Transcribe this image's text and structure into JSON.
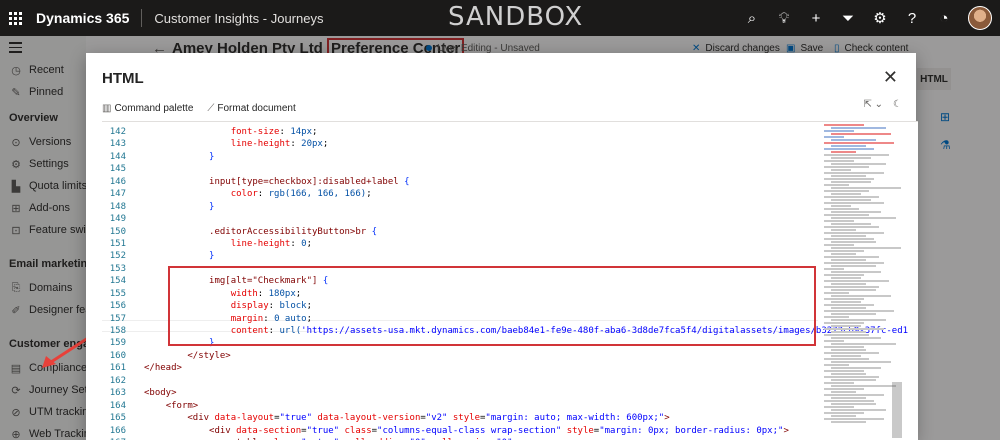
{
  "topbar": {
    "app_name": "Dynamics 365",
    "area_name": "Customer Insights - Journeys",
    "environment_banner": "SANDBOX",
    "icons": [
      "search-icon",
      "lightbulb-icon",
      "plus-icon",
      "filter-icon",
      "gear-icon",
      "help-icon",
      "copilot-icon"
    ]
  },
  "sidebar": {
    "items_top": [
      {
        "label": "Recent",
        "icon": "clock-icon"
      },
      {
        "label": "Pinned",
        "icon": "pin-icon"
      }
    ],
    "section_overview": "Overview",
    "items_overview": [
      {
        "label": "Versions",
        "icon": "versions-icon"
      },
      {
        "label": "Settings",
        "icon": "gear-icon"
      },
      {
        "label": "Quota limits",
        "icon": "quota-icon"
      },
      {
        "label": "Add-ons",
        "icon": "addons-icon"
      },
      {
        "label": "Feature switch",
        "icon": "toggle-icon"
      }
    ],
    "section_email": "Email marketing",
    "items_email": [
      {
        "label": "Domains",
        "icon": "domains-icon"
      },
      {
        "label": "Designer featu",
        "icon": "designer-icon"
      }
    ],
    "section_customer": "Customer engage",
    "items_customer": [
      {
        "label": "Compliance pr",
        "icon": "compliance-icon"
      },
      {
        "label": "Journey Settin",
        "icon": "journey-icon"
      },
      {
        "label": "UTM tracking",
        "icon": "utm-icon"
      },
      {
        "label": "Web Tracking",
        "icon": "web-icon"
      }
    ]
  },
  "record": {
    "title_prefix": "Amey Holden Pty Ltd ",
    "title_highlight": "Preference Center",
    "status": "Live, Editing - Unsaved",
    "commands": [
      {
        "label": "Discard changes",
        "icon": "close-icon"
      },
      {
        "label": "Save",
        "icon": "save-icon"
      },
      {
        "label": "Check content",
        "icon": "document-check-icon"
      }
    ],
    "right_panel_tab": "HTML"
  },
  "modal": {
    "title": "HTML",
    "toolbar": {
      "command_palette": "Command palette",
      "format_document": "Format document"
    }
  },
  "editor": {
    "lines": [
      {
        "n": "142",
        "indent": 4,
        "parts": [
          [
            "prop",
            "font-size"
          ],
          [
            "punc",
            ": "
          ],
          [
            "val",
            "14px"
          ],
          [
            "punc",
            ";"
          ]
        ]
      },
      {
        "n": "143",
        "indent": 4,
        "parts": [
          [
            "prop",
            "line-height"
          ],
          [
            "punc",
            ": "
          ],
          [
            "val",
            "20px"
          ],
          [
            "punc",
            ";"
          ]
        ]
      },
      {
        "n": "144",
        "indent": 3,
        "parts": [
          [
            "br",
            "}"
          ]
        ]
      },
      {
        "n": "145",
        "indent": 0,
        "parts": []
      },
      {
        "n": "146",
        "indent": 3,
        "parts": [
          [
            "sel",
            "input[type=checkbox]:disabled+label "
          ],
          [
            "br",
            "{"
          ]
        ]
      },
      {
        "n": "147",
        "indent": 4,
        "parts": [
          [
            "prop",
            "color"
          ],
          [
            "punc",
            ": "
          ],
          [
            "val",
            "rgb(166, 166, 166)"
          ],
          [
            "punc",
            ";"
          ]
        ]
      },
      {
        "n": "148",
        "indent": 3,
        "parts": [
          [
            "br",
            "}"
          ]
        ]
      },
      {
        "n": "149",
        "indent": 0,
        "parts": []
      },
      {
        "n": "150",
        "indent": 3,
        "parts": [
          [
            "sel",
            ".editorAccessibilityButton>br "
          ],
          [
            "br",
            "{"
          ]
        ]
      },
      {
        "n": "151",
        "indent": 4,
        "parts": [
          [
            "prop",
            "line-height"
          ],
          [
            "punc",
            ": "
          ],
          [
            "val",
            "0"
          ],
          [
            "punc",
            ";"
          ]
        ]
      },
      {
        "n": "152",
        "indent": 3,
        "parts": [
          [
            "br",
            "}"
          ]
        ]
      },
      {
        "n": "153",
        "indent": 0,
        "parts": []
      },
      {
        "n": "154",
        "indent": 3,
        "parts": [
          [
            "sel",
            "img[alt=\"Checkmark\"] "
          ],
          [
            "br",
            "{"
          ]
        ]
      },
      {
        "n": "155",
        "indent": 4,
        "parts": [
          [
            "prop",
            "width"
          ],
          [
            "punc",
            ": "
          ],
          [
            "val",
            "180px"
          ],
          [
            "punc",
            ";"
          ]
        ]
      },
      {
        "n": "156",
        "indent": 4,
        "parts": [
          [
            "prop",
            "display"
          ],
          [
            "punc",
            ": "
          ],
          [
            "val",
            "block"
          ],
          [
            "punc",
            ";"
          ]
        ]
      },
      {
        "n": "157",
        "indent": 4,
        "parts": [
          [
            "prop",
            "margin"
          ],
          [
            "punc",
            ": "
          ],
          [
            "val",
            "0 auto"
          ],
          [
            "punc",
            ";"
          ]
        ]
      },
      {
        "n": "158",
        "indent": 4,
        "parts": [
          [
            "prop",
            "content"
          ],
          [
            "punc",
            ": "
          ],
          [
            "val",
            "url("
          ],
          [
            "str",
            "'https://assets-usa.mkt.dynamics.com/baeb84e1-fe9e-480f-aba6-3d8de7fca5f4/digitalassets/images/b3273cb9-37fc-ed1"
          ]
        ]
      },
      {
        "n": "159",
        "indent": 3,
        "parts": [
          [
            "br",
            "}"
          ]
        ]
      },
      {
        "n": "160",
        "indent": 2,
        "parts": [
          [
            "tag",
            "</style>"
          ]
        ]
      },
      {
        "n": "161",
        "indent": 0,
        "parts": [
          [
            "tag",
            "</head>"
          ]
        ]
      },
      {
        "n": "162",
        "indent": 0,
        "parts": []
      },
      {
        "n": "163",
        "indent": 0,
        "parts": [
          [
            "tag",
            "<body>"
          ]
        ]
      },
      {
        "n": "164",
        "indent": 1,
        "parts": [
          [
            "tag",
            "<form>"
          ]
        ]
      },
      {
        "n": "165",
        "indent": 2,
        "parts": [
          [
            "tag",
            "<div "
          ],
          [
            "attr",
            "data-layout"
          ],
          [
            "punc",
            "="
          ],
          [
            "str",
            "\"true\" "
          ],
          [
            "attr",
            "data-layout-version"
          ],
          [
            "punc",
            "="
          ],
          [
            "str",
            "\"v2\" "
          ],
          [
            "attr",
            "style"
          ],
          [
            "punc",
            "="
          ],
          [
            "str",
            "\"margin: auto; max-width: 600px;\""
          ],
          [
            "tag",
            ">"
          ]
        ]
      },
      {
        "n": "166",
        "indent": 3,
        "parts": [
          [
            "tag",
            "<div "
          ],
          [
            "attr",
            "data-section"
          ],
          [
            "punc",
            "="
          ],
          [
            "str",
            "\"true\" "
          ],
          [
            "attr",
            "class"
          ],
          [
            "punc",
            "="
          ],
          [
            "str",
            "\"columns-equal-class wrap-section\" "
          ],
          [
            "attr",
            "style"
          ],
          [
            "punc",
            "="
          ],
          [
            "str",
            "\"margin: 0px; border-radius: 0px;\""
          ],
          [
            "tag",
            ">"
          ]
        ]
      },
      {
        "n": "167",
        "indent": 4,
        "parts": [
          [
            "tag",
            "<table "
          ],
          [
            "attr",
            "class"
          ],
          [
            "punc",
            "="
          ],
          [
            "str",
            "\"outer\" "
          ],
          [
            "attr",
            "cellpadding"
          ],
          [
            "punc",
            "="
          ],
          [
            "str",
            "\"0\" "
          ],
          [
            "attr",
            "cellspacing"
          ],
          [
            "punc",
            "="
          ],
          [
            "str",
            "\"0\""
          ]
        ]
      }
    ]
  }
}
